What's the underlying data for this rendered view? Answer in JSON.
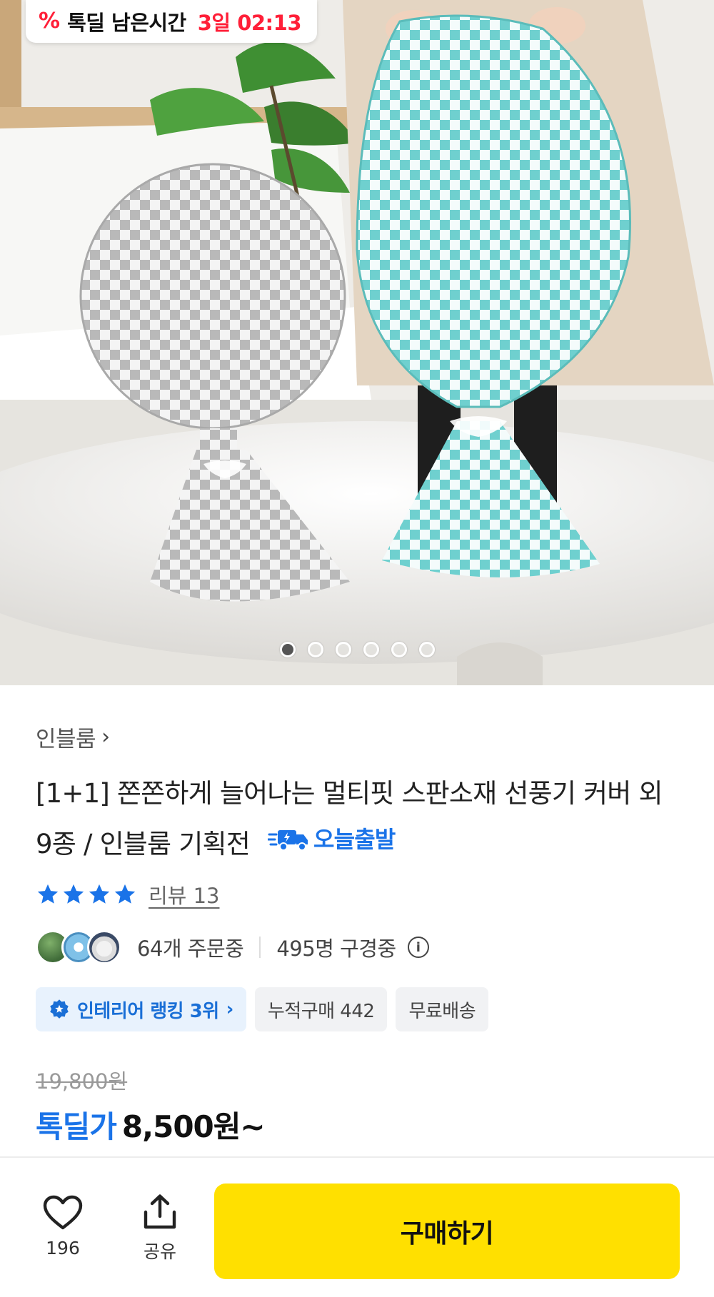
{
  "deal_badge": {
    "icon": "percent-icon",
    "label": "톡딜 남은시간",
    "time_left": "3일 02:13"
  },
  "carousel": {
    "total": 6,
    "active": 1
  },
  "product": {
    "brand": "인블룸",
    "title": "[1+1] 쫀쫀하게 늘어나는 멀티핏 스판소재 선풍기 커버 외 9종 / 인블룸 기획전",
    "shipping_badge": "오늘출발",
    "rating_stars": 4,
    "review_label": "리뷰 13",
    "orders_label": "64개 주문중",
    "viewers_label": "495명 구경중",
    "tags": [
      "인테리어 랭킹 3위",
      "누적구매 442",
      "무료배송"
    ],
    "original_price": "19,800원",
    "deal_price_label": "톡딜가",
    "deal_price": "8,500원~"
  },
  "bottom_bar": {
    "like_count": "196",
    "share_label": "공유",
    "buy_label": "구매하기"
  },
  "colors": {
    "accent_blue": "#1a73e8",
    "deal_red": "#ff1f38",
    "buy_yellow": "#ffe000"
  }
}
